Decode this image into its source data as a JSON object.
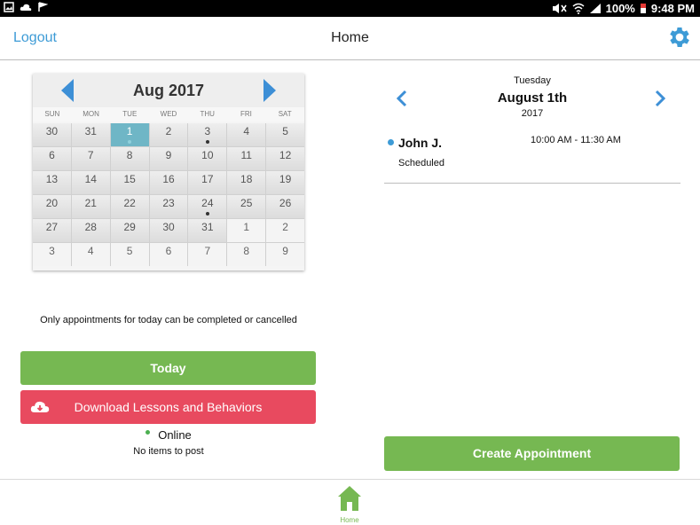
{
  "status_bar": {
    "battery": "100%",
    "time": "9:48 PM"
  },
  "header": {
    "logout": "Logout",
    "title": "Home",
    "settings_icon": "gear-icon",
    "accent": "#3d9bd6"
  },
  "calendar": {
    "month": "Aug 2017",
    "weekdays": [
      "SUN",
      "MON",
      "TUE",
      "WED",
      "THU",
      "FRI",
      "SAT"
    ],
    "weeks": [
      [
        {
          "d": "30"
        },
        {
          "d": "31"
        },
        {
          "d": "1",
          "selected": true
        },
        {
          "d": "2"
        },
        {
          "d": "3",
          "dot": true
        },
        {
          "d": "4"
        },
        {
          "d": "5"
        }
      ],
      [
        {
          "d": "6"
        },
        {
          "d": "7"
        },
        {
          "d": "8"
        },
        {
          "d": "9"
        },
        {
          "d": "10"
        },
        {
          "d": "11"
        },
        {
          "d": "12"
        }
      ],
      [
        {
          "d": "13"
        },
        {
          "d": "14"
        },
        {
          "d": "15"
        },
        {
          "d": "16"
        },
        {
          "d": "17"
        },
        {
          "d": "18"
        },
        {
          "d": "19"
        }
      ],
      [
        {
          "d": "20"
        },
        {
          "d": "21"
        },
        {
          "d": "22"
        },
        {
          "d": "23"
        },
        {
          "d": "24",
          "dot": true
        },
        {
          "d": "25"
        },
        {
          "d": "26"
        }
      ],
      [
        {
          "d": "27"
        },
        {
          "d": "28"
        },
        {
          "d": "29"
        },
        {
          "d": "30"
        },
        {
          "d": "31"
        },
        {
          "d": "1",
          "other": true
        },
        {
          "d": "2",
          "other": true
        }
      ],
      [
        {
          "d": "3",
          "other": true
        },
        {
          "d": "4",
          "other": true
        },
        {
          "d": "5",
          "other": true
        },
        {
          "d": "6",
          "other": true
        },
        {
          "d": "7",
          "other": true
        },
        {
          "d": "8",
          "other": true
        },
        {
          "d": "9",
          "other": true
        }
      ]
    ]
  },
  "left": {
    "notice": "Only appointments for today can be completed or cancelled",
    "today_button": "Today",
    "download_button": "Download Lessons and Behaviors",
    "online": "Online",
    "post_status": "No items to post"
  },
  "day": {
    "weekday": "Tuesday",
    "date": "August 1th",
    "year": "2017"
  },
  "appointments": [
    {
      "name": "John J.",
      "time": "10:00 AM - 11:30 AM",
      "status": "Scheduled"
    }
  ],
  "create_button": "Create Appointment",
  "bottom_nav": {
    "home": "Home"
  },
  "colors": {
    "green": "#76b852",
    "red": "#e84a5f",
    "blue": "#3d9bd6",
    "selected_day": "#6fb6c6"
  }
}
